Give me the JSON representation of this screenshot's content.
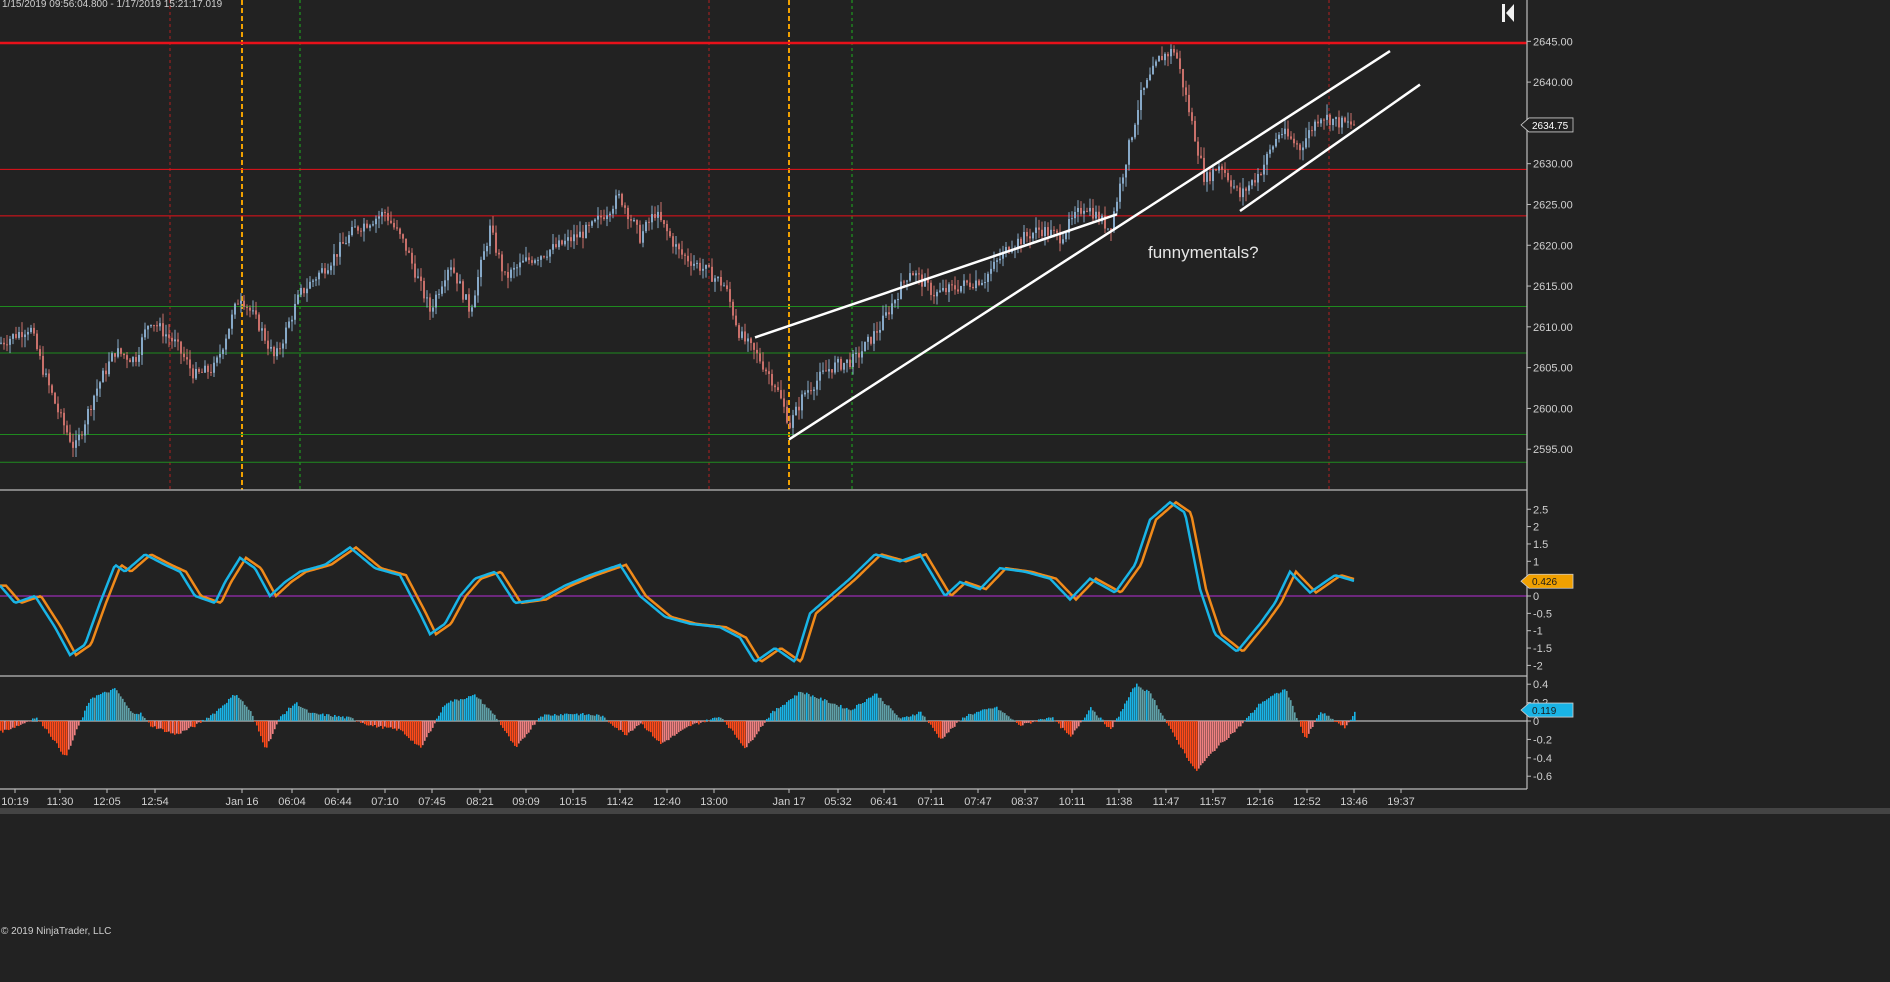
{
  "header": {
    "date_range": "1/15/2019 09:56:04.800 - 1/17/2019 15:21:17.019"
  },
  "copyright": "© 2019 NinjaTrader, LLC",
  "annotation": "funnymentals?",
  "colors": {
    "background": "#222222",
    "candle_up": "#87a9c8",
    "candle_down": "#c9706a",
    "resistance": "#e8111a",
    "support": "#1f8a1f",
    "session_orange": "#f0a000",
    "session_green": "#1fb01f",
    "session_red": "#b02020",
    "stoch_k": "#19b4e6",
    "stoch_d": "#f08a1a",
    "zero_line": "#b52fd6",
    "hist_pos": "#19b4e6",
    "hist_pos_fade": "#5fa0a8",
    "hist_neg": "#ff4a1a",
    "hist_neg_fade": "#f08080"
  },
  "chart_data": [
    {
      "type": "candlestick",
      "title": "",
      "ylim": [
        2590,
        2647
      ],
      "y_ticks": [
        "2645.00",
        "2640.00",
        "2635.00",
        "2630.00",
        "2625.00",
        "2620.00",
        "2615.00",
        "2610.00",
        "2605.00",
        "2600.00",
        "2595.00"
      ],
      "last_price": "2634.75",
      "horizontal_levels": {
        "red": [
          2644.8,
          2629.3,
          2623.6
        ],
        "green": [
          2612.5,
          2606.8,
          2596.8,
          2593.4
        ]
      },
      "price_path": [
        [
          0,
          2608
        ],
        [
          30,
          2610
        ],
        [
          45,
          2604
        ],
        [
          60,
          2599
        ],
        [
          75,
          2595
        ],
        [
          95,
          2602
        ],
        [
          115,
          2607
        ],
        [
          135,
          2606
        ],
        [
          150,
          2611
        ],
        [
          175,
          2608
        ],
        [
          195,
          2604
        ],
        [
          215,
          2605
        ],
        [
          240,
          2614
        ],
        [
          260,
          2610
        ],
        [
          275,
          2606
        ],
        [
          300,
          2614
        ],
        [
          330,
          2618
        ],
        [
          355,
          2622
        ],
        [
          385,
          2624
        ],
        [
          405,
          2620
        ],
        [
          430,
          2612
        ],
        [
          450,
          2618
        ],
        [
          470,
          2612
        ],
        [
          490,
          2622
        ],
        [
          505,
          2616
        ],
        [
          525,
          2618
        ],
        [
          560,
          2620
        ],
        [
          590,
          2622
        ],
        [
          620,
          2626
        ],
        [
          640,
          2621
        ],
        [
          655,
          2624
        ],
        [
          680,
          2619
        ],
        [
          705,
          2617
        ],
        [
          725,
          2615
        ],
        [
          740,
          2609
        ],
        [
          760,
          2606
        ],
        [
          775,
          2603
        ],
        [
          790,
          2598
        ],
        [
          805,
          2602
        ],
        [
          830,
          2605
        ],
        [
          855,
          2606
        ],
        [
          880,
          2610
        ],
        [
          910,
          2617
        ],
        [
          935,
          2614
        ],
        [
          960,
          2615
        ],
        [
          985,
          2616
        ],
        [
          1010,
          2620
        ],
        [
          1040,
          2622
        ],
        [
          1060,
          2621
        ],
        [
          1085,
          2625
        ],
        [
          1110,
          2622
        ],
        [
          1125,
          2630
        ],
        [
          1140,
          2638
        ],
        [
          1160,
          2643
        ],
        [
          1175,
          2644
        ],
        [
          1190,
          2636
        ],
        [
          1205,
          2628
        ],
        [
          1220,
          2630
        ],
        [
          1240,
          2626
        ],
        [
          1260,
          2629
        ],
        [
          1280,
          2634
        ],
        [
          1300,
          2632
        ],
        [
          1320,
          2636
        ],
        [
          1340,
          2635
        ],
        [
          1355,
          2634.75
        ]
      ],
      "trend_lines": [
        {
          "from": [
            755,
            2608.7
          ],
          "to": [
            1117,
            2623.8
          ]
        },
        {
          "from": [
            789,
            2596.2
          ],
          "to": [
            1390,
            2643.8
          ]
        },
        {
          "from": [
            1240,
            2624.2
          ],
          "to": [
            1420,
            2639.7
          ]
        }
      ]
    },
    {
      "type": "line",
      "title": "",
      "ylim": [
        -2.1,
        2.8
      ],
      "y_ticks": [
        "2.5",
        "2",
        "1.5",
        "1",
        "0.5",
        "0",
        "-0.5",
        "-1",
        "-1.5",
        "-2"
      ],
      "last_value": "0.426",
      "path": [
        [
          0,
          0.3
        ],
        [
          15,
          -0.2
        ],
        [
          35,
          0
        ],
        [
          55,
          -0.9
        ],
        [
          70,
          -1.7
        ],
        [
          85,
          -1.4
        ],
        [
          100,
          -0.2
        ],
        [
          115,
          0.9
        ],
        [
          125,
          0.7
        ],
        [
          145,
          1.2
        ],
        [
          165,
          0.9
        ],
        [
          180,
          0.7
        ],
        [
          195,
          0
        ],
        [
          215,
          -0.2
        ],
        [
          225,
          0.4
        ],
        [
          240,
          1.1
        ],
        [
          255,
          0.8
        ],
        [
          270,
          0
        ],
        [
          285,
          0.4
        ],
        [
          300,
          0.7
        ],
        [
          325,
          0.9
        ],
        [
          350,
          1.4
        ],
        [
          375,
          0.8
        ],
        [
          400,
          0.6
        ],
        [
          420,
          -0.5
        ],
        [
          430,
          -1.1
        ],
        [
          445,
          -0.8
        ],
        [
          460,
          0
        ],
        [
          475,
          0.5
        ],
        [
          495,
          0.7
        ],
        [
          515,
          -0.2
        ],
        [
          540,
          -0.1
        ],
        [
          565,
          0.3
        ],
        [
          590,
          0.6
        ],
        [
          620,
          0.9
        ],
        [
          640,
          0
        ],
        [
          665,
          -0.6
        ],
        [
          690,
          -0.8
        ],
        [
          720,
          -0.9
        ],
        [
          740,
          -1.2
        ],
        [
          755,
          -1.9
        ],
        [
          775,
          -1.5
        ],
        [
          795,
          -1.9
        ],
        [
          810,
          -0.5
        ],
        [
          830,
          0
        ],
        [
          850,
          0.5
        ],
        [
          875,
          1.2
        ],
        [
          900,
          1
        ],
        [
          920,
          1.2
        ],
        [
          945,
          0
        ],
        [
          960,
          0.4
        ],
        [
          980,
          0.2
        ],
        [
          1000,
          0.8
        ],
        [
          1025,
          0.7
        ],
        [
          1050,
          0.5
        ],
        [
          1070,
          -0.1
        ],
        [
          1090,
          0.5
        ],
        [
          1115,
          0.1
        ],
        [
          1135,
          0.9
        ],
        [
          1150,
          2.2
        ],
        [
          1170,
          2.7
        ],
        [
          1185,
          2.4
        ],
        [
          1200,
          0.2
        ],
        [
          1215,
          -1.1
        ],
        [
          1237,
          -1.6
        ],
        [
          1260,
          -0.8
        ],
        [
          1275,
          -0.2
        ],
        [
          1290,
          0.7
        ],
        [
          1310,
          0.1
        ],
        [
          1335,
          0.6
        ],
        [
          1355,
          0.426
        ]
      ]
    },
    {
      "type": "bar",
      "title": "",
      "ylim": [
        -0.68,
        0.45
      ],
      "y_ticks": [
        "0.4",
        "0.2",
        "0",
        "-0.2",
        "-0.4",
        "-0.6"
      ],
      "last_value": "0.119",
      "profile": [
        [
          0,
          -0.12
        ],
        [
          20,
          -0.04
        ],
        [
          35,
          0.04
        ],
        [
          45,
          -0.08
        ],
        [
          65,
          -0.4
        ],
        [
          78,
          -0.05
        ],
        [
          90,
          0.25
        ],
        [
          115,
          0.35
        ],
        [
          130,
          0.1
        ],
        [
          140,
          0.08
        ],
        [
          150,
          -0.05
        ],
        [
          175,
          -0.15
        ],
        [
          195,
          -0.05
        ],
        [
          215,
          0.1
        ],
        [
          235,
          0.3
        ],
        [
          250,
          0.1
        ],
        [
          265,
          -0.3
        ],
        [
          280,
          0.05
        ],
        [
          295,
          0.2
        ],
        [
          310,
          0.08
        ],
        [
          330,
          0.06
        ],
        [
          350,
          0.03
        ],
        [
          370,
          -0.05
        ],
        [
          400,
          -0.1
        ],
        [
          420,
          -0.3
        ],
        [
          445,
          0.2
        ],
        [
          475,
          0.28
        ],
        [
          495,
          0.05
        ],
        [
          515,
          -0.3
        ],
        [
          540,
          0.06
        ],
        [
          570,
          0.08
        ],
        [
          600,
          0.06
        ],
        [
          625,
          -0.15
        ],
        [
          640,
          -0.02
        ],
        [
          660,
          -0.25
        ],
        [
          690,
          -0.05
        ],
        [
          720,
          0.05
        ],
        [
          745,
          -0.3
        ],
        [
          770,
          0.08
        ],
        [
          800,
          0.32
        ],
        [
          830,
          0.2
        ],
        [
          850,
          0.12
        ],
        [
          875,
          0.3
        ],
        [
          900,
          0.02
        ],
        [
          920,
          0.1
        ],
        [
          940,
          -0.2
        ],
        [
          965,
          0.06
        ],
        [
          995,
          0.15
        ],
        [
          1020,
          -0.05
        ],
        [
          1050,
          0.05
        ],
        [
          1070,
          -0.18
        ],
        [
          1090,
          0.15
        ],
        [
          1110,
          -0.1
        ],
        [
          1135,
          0.4
        ],
        [
          1150,
          0.3
        ],
        [
          1170,
          -0.1
        ],
        [
          1195,
          -0.55
        ],
        [
          1215,
          -0.3
        ],
        [
          1240,
          -0.05
        ],
        [
          1260,
          0.2
        ],
        [
          1285,
          0.35
        ],
        [
          1305,
          -0.2
        ],
        [
          1320,
          0.1
        ],
        [
          1345,
          -0.08
        ],
        [
          1355,
          0.119
        ]
      ]
    }
  ],
  "sessions": {
    "orange": [
      242,
      789
    ],
    "green": [
      300,
      852
    ],
    "red": [
      170,
      709,
      1329
    ]
  },
  "x_ticks": [
    {
      "x": 15,
      "label": "10:19"
    },
    {
      "x": 60,
      "label": "11:30"
    },
    {
      "x": 107,
      "label": "12:05"
    },
    {
      "x": 155,
      "label": "12:54"
    },
    {
      "x": 242,
      "label": "Jan 16"
    },
    {
      "x": 292,
      "label": "06:04"
    },
    {
      "x": 338,
      "label": "06:44"
    },
    {
      "x": 385,
      "label": "07:10"
    },
    {
      "x": 432,
      "label": "07:45"
    },
    {
      "x": 480,
      "label": "08:21"
    },
    {
      "x": 526,
      "label": "09:09"
    },
    {
      "x": 573,
      "label": "10:15"
    },
    {
      "x": 620,
      "label": "11:42"
    },
    {
      "x": 667,
      "label": "12:40"
    },
    {
      "x": 714,
      "label": "13:00"
    },
    {
      "x": 789,
      "label": "Jan 17"
    },
    {
      "x": 838,
      "label": "05:32"
    },
    {
      "x": 884,
      "label": "06:41"
    },
    {
      "x": 931,
      "label": "07:11"
    },
    {
      "x": 978,
      "label": "07:47"
    },
    {
      "x": 1025,
      "label": "08:37"
    },
    {
      "x": 1072,
      "label": "10:11"
    },
    {
      "x": 1119,
      "label": "11:38"
    },
    {
      "x": 1166,
      "label": "11:47"
    },
    {
      "x": 1213,
      "label": "11:57"
    },
    {
      "x": 1260,
      "label": "12:16"
    },
    {
      "x": 1307,
      "label": "12:52"
    },
    {
      "x": 1354,
      "label": "13:46"
    },
    {
      "x": 1401,
      "label": "19:37"
    }
  ]
}
